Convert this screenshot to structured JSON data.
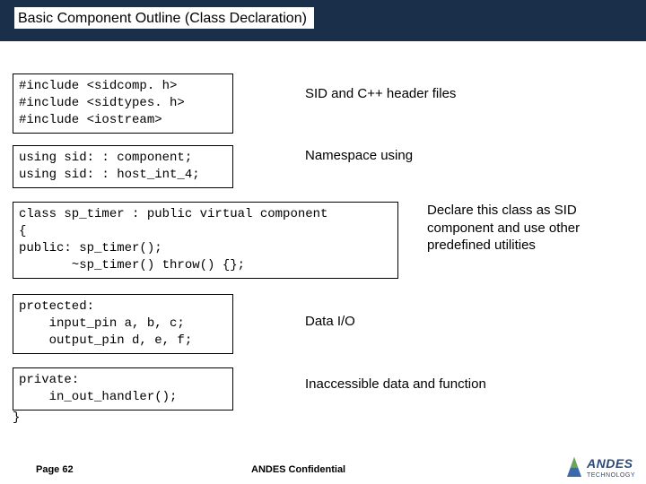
{
  "title": "Basic Component Outline (Class Declaration)",
  "code": {
    "includes": "#include <sidcomp. h>\n#include <sidtypes. h>\n#include <iostream>",
    "usings": "using sid: : component;\nusing sid: : host_int_4;",
    "classdecl": "class sp_timer : public virtual component\n{\npublic: sp_timer();\n       ~sp_timer() throw() {};",
    "protected": "protected:\n    input_pin a, b, c;\n    output_pin d, e, f;",
    "private": "private:\n    in_out_handler();",
    "closebrace": "}"
  },
  "labels": {
    "includes": "SID and C++ header files",
    "usings": "Namespace using",
    "classdecl": "Declare this class as SID component and use other predefined utilities",
    "protected": "Data I/O",
    "private": "Inaccessible data and function"
  },
  "footer": {
    "page": "Page 62",
    "conf": "ANDES Confidential"
  },
  "logo": {
    "name": "ANDES",
    "sub": "TECHNOLOGY"
  }
}
